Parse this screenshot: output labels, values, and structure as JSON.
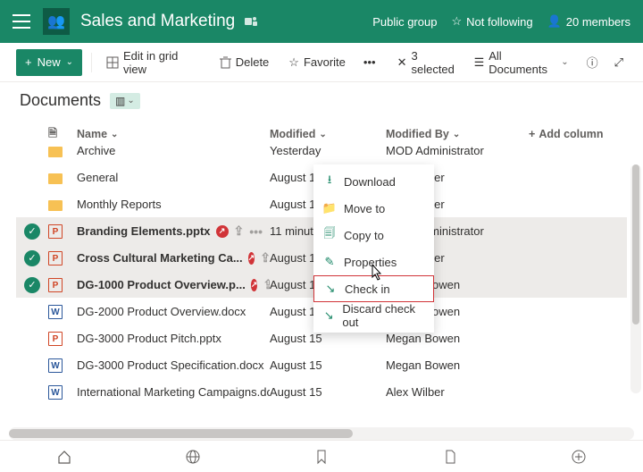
{
  "header": {
    "title": "Sales and Marketing",
    "public_group": "Public group",
    "not_following": "Not following",
    "members": "20 members"
  },
  "toolbar": {
    "new": "New",
    "edit_grid": "Edit in grid view",
    "delete": "Delete",
    "favorite": "Favorite",
    "selected": "3 selected",
    "all_documents": "All Documents"
  },
  "breadcrumb": {
    "label": "Documents"
  },
  "columns": {
    "name": "Name",
    "modified": "Modified",
    "modified_by": "Modified By",
    "add": "Add column"
  },
  "rows": [
    {
      "sel": false,
      "icon": "folder",
      "name": "Archive",
      "co": false,
      "mod": "Yesterday",
      "by": "MOD Administrator",
      "cut": true
    },
    {
      "sel": false,
      "icon": "folder",
      "name": "General",
      "co": false,
      "mod": "August 15",
      "by": "Alex Wilber"
    },
    {
      "sel": false,
      "icon": "folder",
      "name": "Monthly Reports",
      "co": false,
      "mod": "August 15",
      "by": "Alex Wilber"
    },
    {
      "sel": true,
      "icon": "pptx",
      "name": "Branding Elements.pptx",
      "co": true,
      "more": true,
      "mod": "11 minutes ago",
      "by": "MOD Administrator"
    },
    {
      "sel": true,
      "icon": "pptx",
      "name": "Cross Cultural Marketing Ca...",
      "co": true,
      "more": true,
      "mod": "August 15",
      "by": "Alex Wilber"
    },
    {
      "sel": true,
      "icon": "pptx",
      "name": "DG-1000 Product Overview.p...",
      "co": true,
      "more": true,
      "mod": "August 15",
      "by": "Megan Bowen"
    },
    {
      "sel": false,
      "icon": "docx",
      "name": "DG-2000 Product Overview.docx",
      "co": false,
      "mod": "August 15",
      "by": "Megan Bowen"
    },
    {
      "sel": false,
      "icon": "pptx",
      "name": "DG-3000 Product Pitch.pptx",
      "co": false,
      "mod": "August 15",
      "by": "Megan Bowen"
    },
    {
      "sel": false,
      "icon": "docx",
      "name": "DG-3000 Product Specification.docx",
      "co": false,
      "mod": "August 15",
      "by": "Megan Bowen"
    },
    {
      "sel": false,
      "icon": "docx",
      "name": "International Marketing Campaigns.docx",
      "co": false,
      "mod": "August 15",
      "by": "Alex Wilber"
    }
  ],
  "menu": {
    "download": "Download",
    "move_to": "Move to",
    "copy_to": "Copy to",
    "properties": "Properties",
    "check_in": "Check in",
    "discard": "Discard check out"
  }
}
